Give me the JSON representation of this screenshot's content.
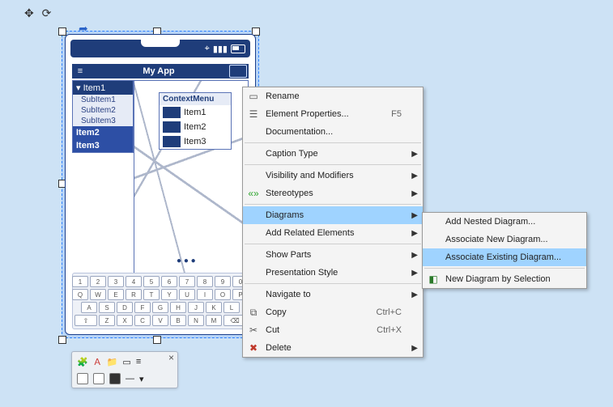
{
  "phone": {
    "title": "My App",
    "tree": {
      "header": "Item1",
      "subs": [
        "SubItem1",
        "SubItem2",
        "SubItem3"
      ],
      "items": [
        "Item2",
        "Item3"
      ]
    },
    "context": {
      "title": "ContextMenu",
      "rows": [
        "Item1",
        "Item2",
        "Item3"
      ]
    }
  },
  "kbd": {
    "row1": [
      "1",
      "2",
      "3",
      "4",
      "5",
      "6",
      "7",
      "8",
      "9",
      "0"
    ],
    "row2": [
      "Q",
      "W",
      "E",
      "R",
      "T",
      "Y",
      "U",
      "I",
      "O",
      "P"
    ],
    "row3": [
      "A",
      "S",
      "D",
      "F",
      "G",
      "H",
      "J",
      "K",
      "L"
    ],
    "row4": [
      "⇧",
      "Z",
      "X",
      "C",
      "V",
      "B",
      "N",
      "M",
      "⌫"
    ]
  },
  "menu": {
    "rename": "Rename",
    "eprops": "Element Properties...",
    "eprops_sc": "F5",
    "doc": "Documentation...",
    "caption": "Caption Type",
    "vis": "Visibility and Modifiers",
    "stereo": "Stereotypes",
    "diagrams": "Diagrams",
    "addrel": "Add Related Elements",
    "showparts": "Show Parts",
    "pstyle": "Presentation Style",
    "nav": "Navigate to",
    "copy": "Copy",
    "copy_sc": "Ctrl+C",
    "cut": "Cut",
    "cut_sc": "Ctrl+X",
    "del": "Delete"
  },
  "submenu": {
    "addnested": "Add Nested Diagram...",
    "assocnew": "Associate New Diagram...",
    "assocex": "Associate Existing Diagram...",
    "newbysel": "New Diagram by Selection"
  }
}
